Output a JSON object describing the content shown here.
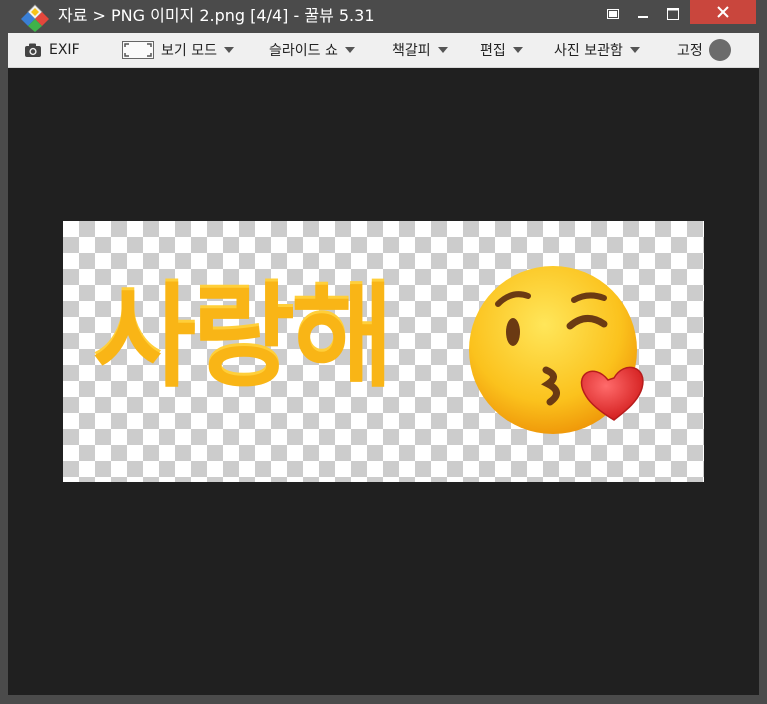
{
  "window": {
    "title": "자료 > PNG 이미지 2.png [4/4] - 꿀뷰 5.31",
    "close_color": "#c9463d"
  },
  "toolbar": {
    "exif_label": "EXIF",
    "view_mode_label": "보기 모드",
    "slideshow_label": "슬라이드 쇼",
    "bookmark_label": "책갈피",
    "edit_label": "편집",
    "photo_storage_label": "사진 보관함",
    "pin_label": "고정"
  },
  "image": {
    "text": "사랑해",
    "text_color": "#f9b516",
    "emoji": "kissing-face-with-heart-emoji"
  }
}
